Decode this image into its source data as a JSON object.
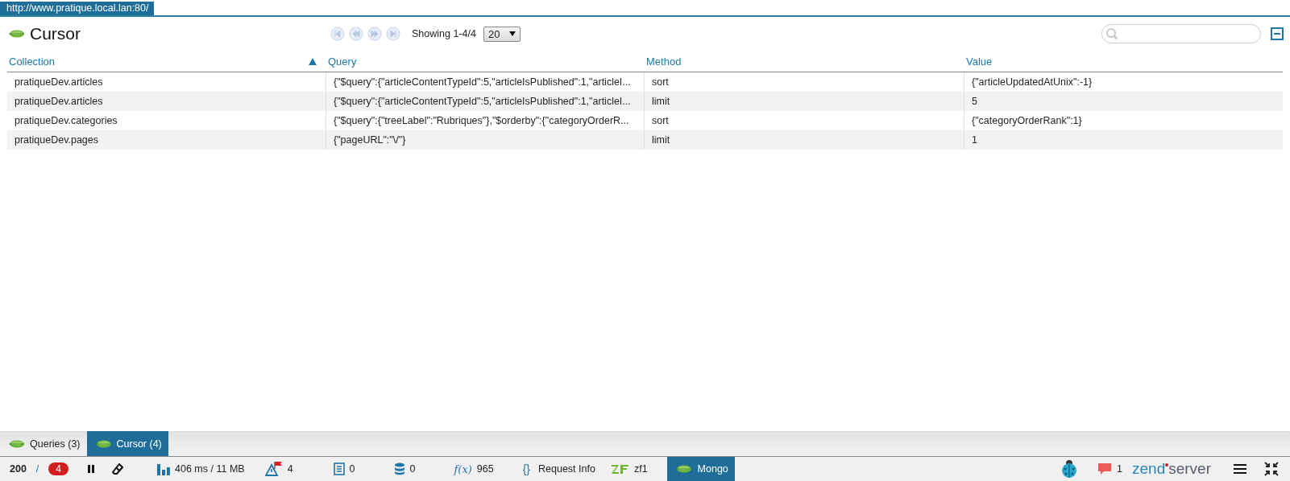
{
  "url_tab": "http://www.pratique.local.lan:80/",
  "panel": {
    "title": "Cursor",
    "pager": {
      "showing": "Showing 1-4/4",
      "page_size": "20"
    }
  },
  "table": {
    "columns": [
      {
        "label": "Collection",
        "sorted": true
      },
      {
        "label": "Query",
        "sorted": false
      },
      {
        "label": "Method",
        "sorted": false
      },
      {
        "label": "Value",
        "sorted": false
      }
    ],
    "rows": [
      [
        "pratiqueDev.articles",
        "{\"$query\":{\"articleContentTypeId\":5,\"articleIsPublished\":1,\"articleI...",
        "sort",
        "{\"articleUpdatedAtUnix\":-1}"
      ],
      [
        "pratiqueDev.articles",
        "{\"$query\":{\"articleContentTypeId\":5,\"articleIsPublished\":1,\"articleI...",
        "limit",
        "5"
      ],
      [
        "pratiqueDev.categories",
        "{\"$query\":{\"treeLabel\":\"Rubriques\"},\"$orderby\":{\"categoryOrderR...",
        "sort",
        "{\"categoryOrderRank\":1}"
      ],
      [
        "pratiqueDev.pages",
        "{\"pageURL\":\"\\/\"}",
        "limit",
        "1"
      ]
    ]
  },
  "bottom_tabs": [
    {
      "label": "Queries (3)",
      "selected": false
    },
    {
      "label": "Cursor (4)",
      "selected": true
    }
  ],
  "status_bar": {
    "left": [
      {
        "kind": "code",
        "text": "200"
      },
      {
        "kind": "slash",
        "text": "/"
      },
      {
        "kind": "errors",
        "text": "4"
      },
      {
        "kind": "pause"
      },
      {
        "kind": "eraser"
      },
      {
        "kind": "timing",
        "text": "406 ms / 11 MB"
      },
      {
        "kind": "alerts",
        "text": "4"
      },
      {
        "kind": "logs",
        "text": "0"
      },
      {
        "kind": "database",
        "text": "0"
      },
      {
        "kind": "functions",
        "glyph": "f(x)",
        "text": "965"
      },
      {
        "kind": "request",
        "glyph": "{}",
        "text": "Request Info"
      },
      {
        "kind": "framework",
        "text": "zf1"
      },
      {
        "kind": "mongo",
        "text": "Mongo",
        "selected": true
      }
    ],
    "right": [
      {
        "kind": "bug"
      },
      {
        "kind": "comments",
        "text": "1"
      },
      {
        "kind": "logo",
        "text": "zend",
        "text2": "server"
      },
      {
        "kind": "menu"
      },
      {
        "kind": "collapse"
      }
    ]
  }
}
